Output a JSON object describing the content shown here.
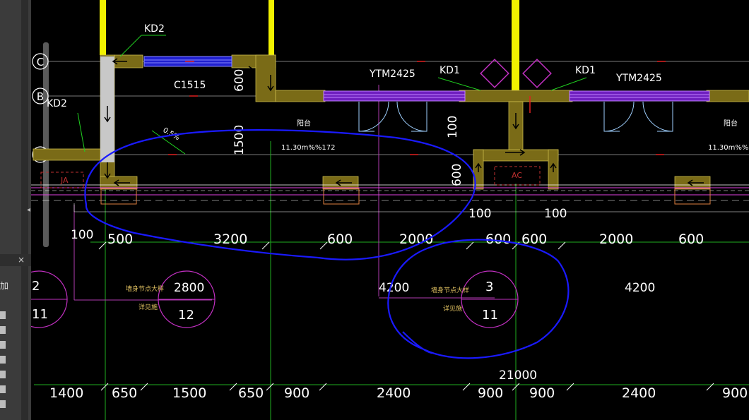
{
  "panel": {
    "close_glyph": "×",
    "add_label": "加"
  },
  "grid_axes": [
    {
      "label": "C"
    },
    {
      "label": "B"
    },
    {
      "label": "A"
    }
  ],
  "texts": {
    "kd2_top": "KD2",
    "kd2_left": "KD2",
    "c1515": "C1515",
    "ytm_left": "YTM2425",
    "ytm_right": "YTM2425",
    "kd1_left": "KD1",
    "kd1_right": "KD1",
    "dim_600_a": "600",
    "dim_1500": "1500",
    "dim_100_v": "100",
    "dim_600_b": "600",
    "balcony_left": "阳台",
    "balcony_right": "阳台",
    "area_left": "11.30m%%172",
    "area_right": "11.30m%%172",
    "slope": "0.5%",
    "dim_100_left": "100",
    "dim_100_mid_a": "100",
    "dim_100_mid_b": "100",
    "ac_label": "AC",
    "ja_label": "JA",
    "node_text_1": "墙身节点大样",
    "node_text_2": "详见施",
    "node_text_3": "墙身节点大样",
    "node_text_4": "详见施",
    "total": "21000"
  },
  "dims_row1": [
    "500",
    "3200",
    "600",
    "2000",
    "600",
    "600",
    "2000",
    "600"
  ],
  "dims_row2": [
    "1400",
    "650",
    "1500",
    "650",
    "900",
    "2400",
    "900",
    "900",
    "2400",
    "900"
  ],
  "dims_mid": [
    "2800",
    "4200",
    "4200"
  ],
  "detail_bubbles": [
    {
      "top": "2",
      "bottom": "11"
    },
    {
      "top": "",
      "bottom": "12"
    },
    {
      "top": "3",
      "bottom": "11"
    }
  ]
}
